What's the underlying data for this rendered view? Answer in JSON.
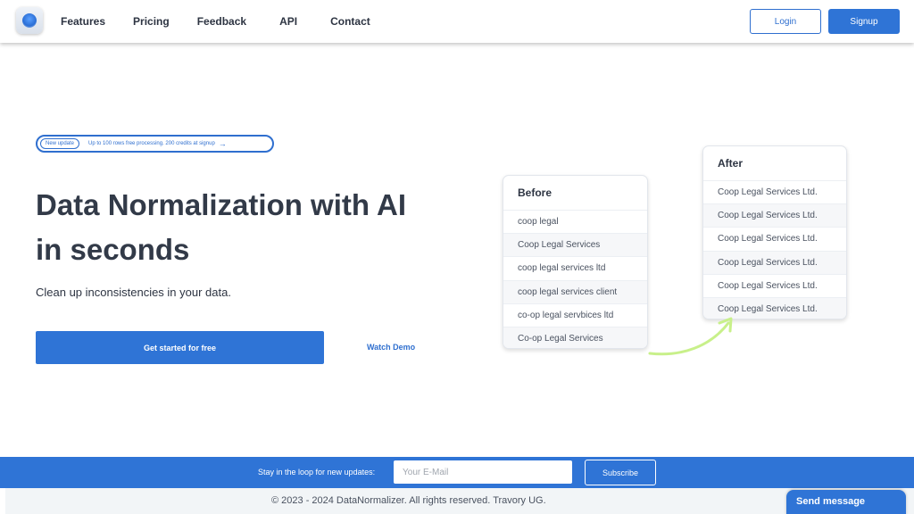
{
  "nav": {
    "links": [
      "Features",
      "Pricing",
      "Feedback",
      "API",
      "Contact"
    ],
    "login_label": "Login",
    "signup_label": "Signup"
  },
  "hero": {
    "badge": "New update",
    "update_text": "Up to 100 rows free processing. 200 credits at signup",
    "title_line1": "Data Normalization with AI",
    "title_line2": "in seconds",
    "subtitle": "Clean up inconsistencies in your data.",
    "cta_label": "Get started for free",
    "demo_label": "Watch Demo"
  },
  "before_card": {
    "title": "Before",
    "rows": [
      "coop legal",
      "Coop Legal Services",
      "coop legal services ltd",
      "coop legal services client",
      "co-op legal servbices ltd",
      "Co-op Legal Services"
    ]
  },
  "after_card": {
    "title": "After",
    "rows": [
      "Coop Legal Services Ltd.",
      "Coop Legal Services Ltd.",
      "Coop Legal Services Ltd.",
      "Coop Legal Services Ltd.",
      "Coop Legal Services Ltd.",
      "Coop Legal Services Ltd."
    ]
  },
  "newsletter": {
    "label": "Stay in the loop for new updates:",
    "placeholder": "Your E-Mail",
    "button_label": "Subscribe"
  },
  "footer": {
    "copyright": "© 2023 - 2024 DataNormalizer. All rights reserved. Travory UG."
  },
  "chat": {
    "label": "Send message"
  },
  "colors": {
    "accent": "#2f74d6",
    "arrow": "#c8f08a"
  },
  "icons": {
    "logo": "blue-orb-logo",
    "update_arrow": "arrow-right-icon",
    "transform_arrow": "curved-arrow-icon"
  }
}
